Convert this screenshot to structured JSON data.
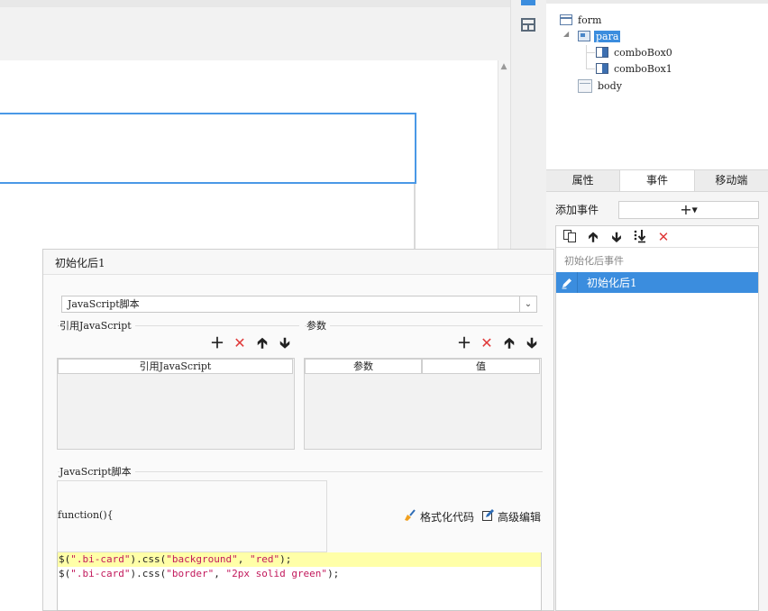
{
  "tree": {
    "nodes": [
      {
        "label": "form",
        "icon": "form-icon"
      },
      {
        "label": "para",
        "icon": "para-icon",
        "selected": true
      },
      {
        "label": "comboBox0",
        "icon": "combobox-icon"
      },
      {
        "label": "comboBox1",
        "icon": "combobox-icon"
      },
      {
        "label": "body",
        "icon": "body-icon"
      }
    ]
  },
  "right_panel": {
    "tabs": [
      {
        "label": "属性",
        "active": false
      },
      {
        "label": "事件",
        "active": true
      },
      {
        "label": "移动端",
        "active": false
      }
    ],
    "add_event_label": "添加事件",
    "add_event_button": "+",
    "event_section": "初始化后事件",
    "events": [
      {
        "label": "初始化后1",
        "selected": true
      }
    ],
    "toolbar_icons": [
      "copy-icon",
      "move-up-icon",
      "move-down-icon",
      "move-to-bottom-icon",
      "delete-icon"
    ]
  },
  "dialog": {
    "title": "初始化后1",
    "script_type": "JavaScript脚本",
    "ref_js_section": "引用JavaScript",
    "params_section": "参数",
    "ref_js_column": "引用JavaScript",
    "param_columns": [
      "参数",
      "值"
    ],
    "js_script_section": "JavaScript脚本",
    "function_header": "function(){",
    "format_code": "格式化代码",
    "advanced_edit": "高级编辑",
    "code_lines": [
      [
        {
          "t": "$(",
          "k": "plain"
        },
        {
          "t": "\".bi-card\"",
          "k": "str"
        },
        {
          "t": ").css(",
          "k": "plain"
        },
        {
          "t": "\"background\"",
          "k": "str"
        },
        {
          "t": ", ",
          "k": "plain"
        },
        {
          "t": "\"red\"",
          "k": "str"
        },
        {
          "t": ");",
          "k": "plain"
        }
      ],
      [
        {
          "t": "$(",
          "k": "plain"
        },
        {
          "t": "\".bi-card\"",
          "k": "str"
        },
        {
          "t": ").css(",
          "k": "plain"
        },
        {
          "t": "\"border\"",
          "k": "str"
        },
        {
          "t": ", ",
          "k": "plain"
        },
        {
          "t": "\"2px solid green\"",
          "k": "str"
        },
        {
          "t": ");",
          "k": "plain"
        }
      ]
    ]
  },
  "colors": {
    "accent": "#3b8dde",
    "delete_red": "#e03a3a",
    "code_string": "#c2185b",
    "code_highlight": "#ffffa8"
  }
}
